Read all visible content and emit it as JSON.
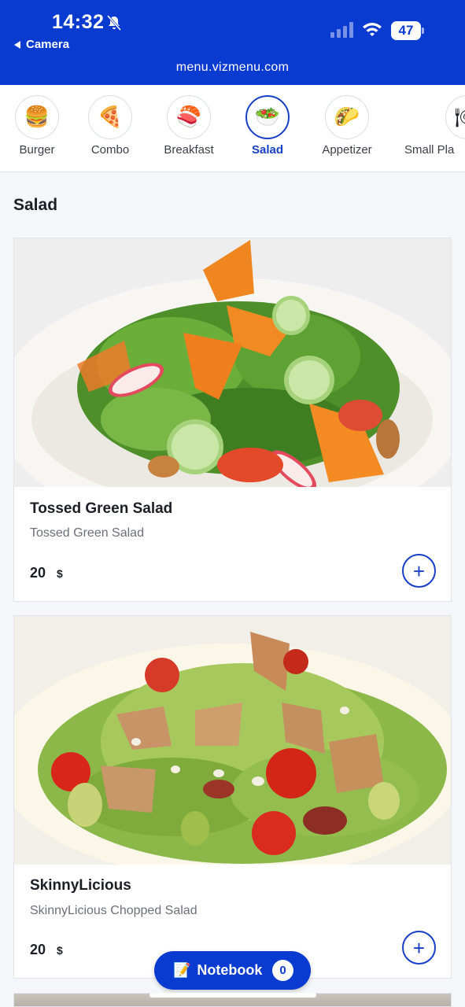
{
  "status": {
    "time": "14:32",
    "back_label": "Camera",
    "battery": "47"
  },
  "browser": {
    "url": "menu.vizmenu.com"
  },
  "categories": [
    {
      "label": "Burger",
      "icon": "burger-icon",
      "glyph": "🍔"
    },
    {
      "label": "Combo",
      "icon": "pizza-icon",
      "glyph": "🍕"
    },
    {
      "label": "Breakfast",
      "icon": "sushi-icon",
      "glyph": "🍣"
    },
    {
      "label": "Salad",
      "icon": "salad-icon",
      "glyph": "🥗",
      "active": true
    },
    {
      "label": "Appetizer",
      "icon": "taco-icon",
      "glyph": "🌮"
    },
    {
      "label": "Small Pla",
      "icon": "small-plates-icon",
      "glyph": "🍽"
    }
  ],
  "section": {
    "title": "Salad"
  },
  "items": [
    {
      "name": "Tossed Green Salad",
      "description": "Tossed Green Salad",
      "price": "20",
      "currency": "$"
    },
    {
      "name": "SkinnyLicious",
      "description": "SkinnyLicious Chopped Salad",
      "price": "20",
      "currency": "$"
    }
  ],
  "notebook": {
    "label": "Notebook",
    "count": "0",
    "icon": "notebook-icon",
    "glyph": "📝"
  },
  "colors": {
    "brand": "#0a3bd0",
    "accent": "#1740c6"
  }
}
